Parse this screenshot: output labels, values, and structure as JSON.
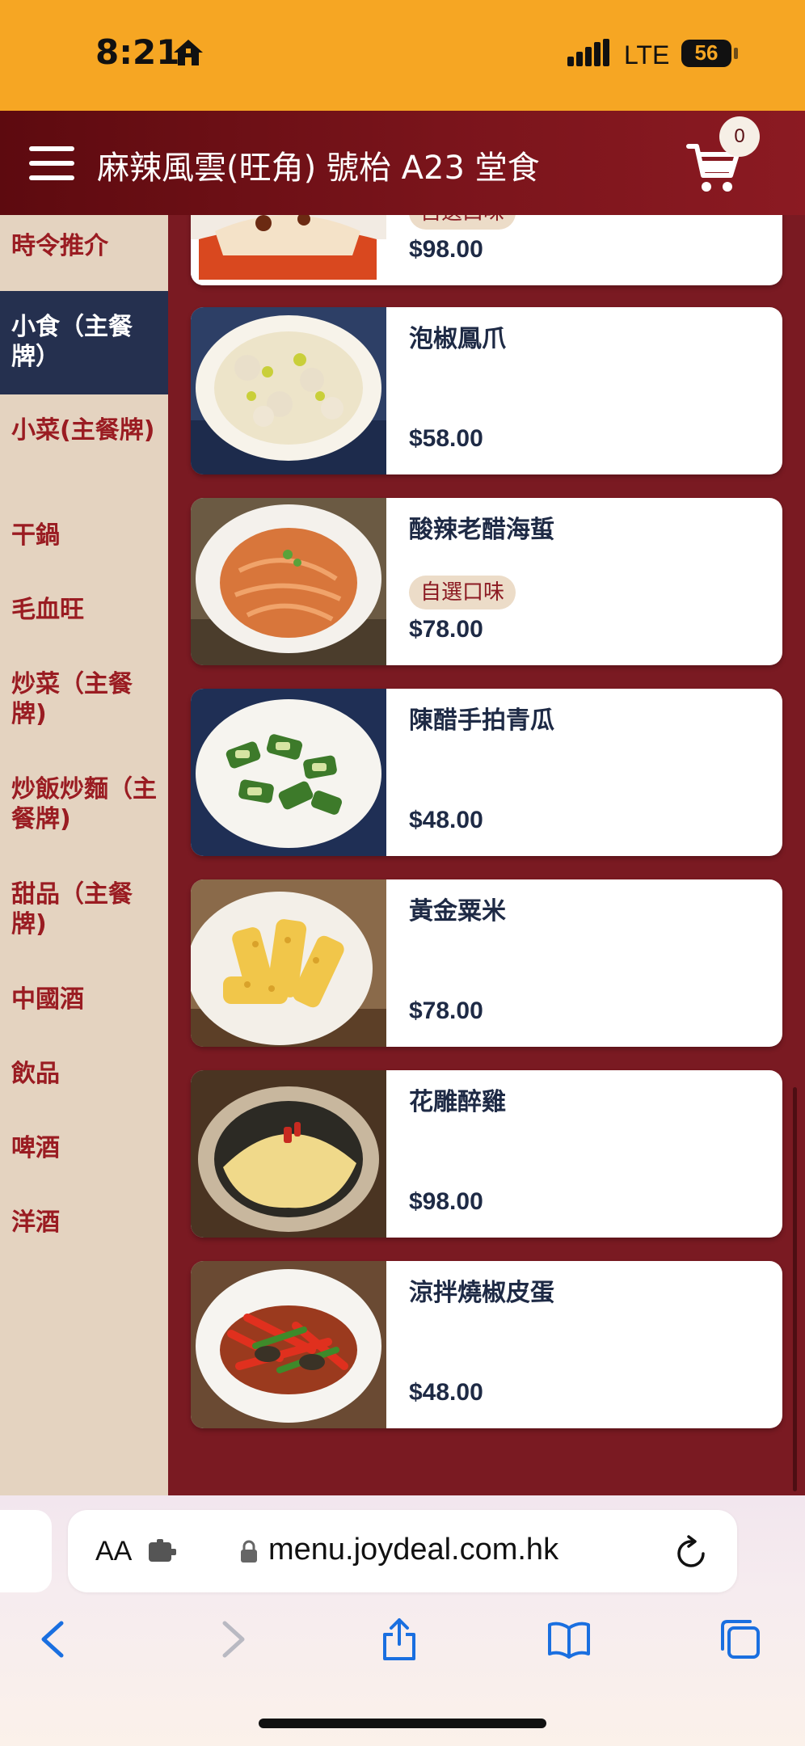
{
  "status_bar": {
    "time": "8:21",
    "network": "LTE",
    "battery": "56"
  },
  "header": {
    "title": "麻辣風雲(旺角) 號枱 A23 堂食",
    "cart_count": "0"
  },
  "sidebar": {
    "items": [
      {
        "label": "時令推介"
      },
      {
        "label": "小食（主餐牌）",
        "active": true
      },
      {
        "label": "小菜(主餐牌)"
      },
      {
        "label": "干鍋"
      },
      {
        "label": "毛血旺"
      },
      {
        "label": "炒菜（主餐牌)"
      },
      {
        "label": "炒飯炒麵（主餐牌)"
      },
      {
        "label": "甜品（主餐牌)"
      },
      {
        "label": "中國酒"
      },
      {
        "label": "飲品"
      },
      {
        "label": "啤酒"
      },
      {
        "label": "洋酒"
      }
    ]
  },
  "menu": {
    "items": [
      {
        "name": "",
        "tag": "自選口味",
        "price": "$98.00"
      },
      {
        "name": "泡椒鳳爪",
        "tag": "",
        "price": "$58.00"
      },
      {
        "name": "酸辣老醋海蜇",
        "tag": "自選口味",
        "price": "$78.00"
      },
      {
        "name": "陳醋手拍青瓜",
        "tag": "",
        "price": "$48.00"
      },
      {
        "name": "黃金粟米",
        "tag": "",
        "price": "$78.00"
      },
      {
        "name": "花雕醉雞",
        "tag": "",
        "price": "$98.00"
      },
      {
        "name": "涼拌燒椒皮蛋",
        "tag": "",
        "price": "$48.00"
      }
    ]
  },
  "browser": {
    "aa_label": "AA",
    "url": "menu.joydeal.com.hk"
  },
  "colors": {
    "status_bar": "#f6a623",
    "header": "#7a141b",
    "sidebar": "#e4d3c0",
    "sidebar_active": "#25304f",
    "content_bg": "#7a1a22",
    "text_dark": "#1e2a45",
    "accent_text": "#9a1c22"
  },
  "icons": {
    "home": "home-icon",
    "signal": "signal-icon",
    "battery": "battery-icon",
    "menu": "hamburger-icon",
    "cart": "cart-icon",
    "back": "back-icon",
    "forward": "forward-icon",
    "share": "share-icon",
    "bookmarks": "bookmarks-icon",
    "tabs": "tabs-icon"
  }
}
